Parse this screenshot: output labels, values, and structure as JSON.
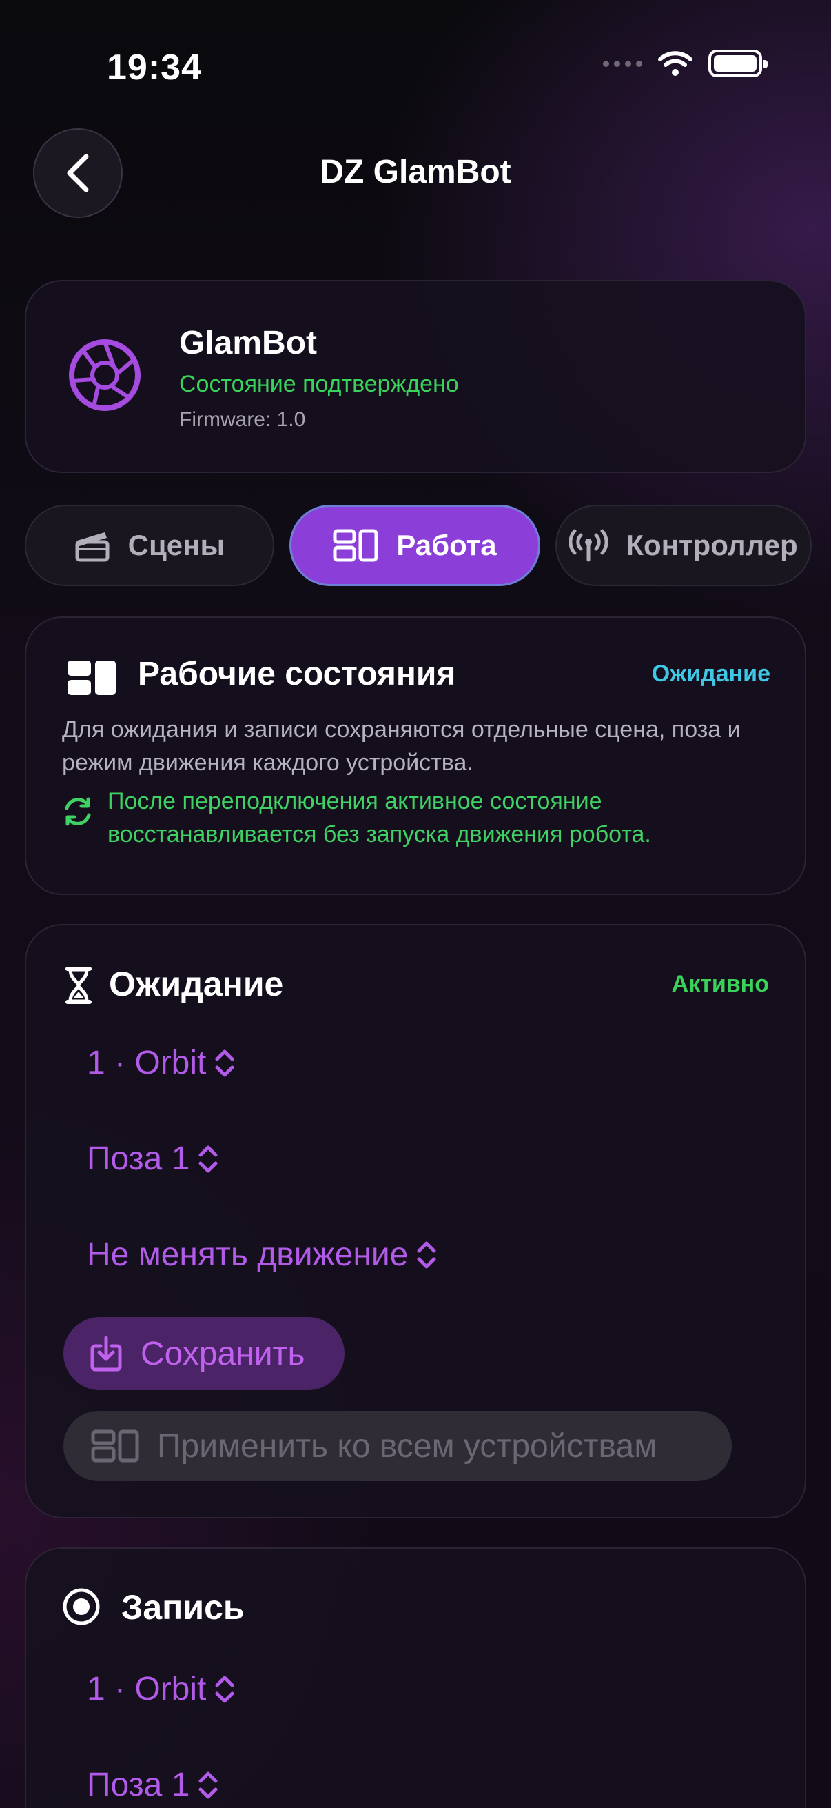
{
  "status_bar": {
    "time": "19:34"
  },
  "nav": {
    "title": "DZ GlamBot"
  },
  "device": {
    "name": "GlamBot",
    "state": "Состояние подтверждено",
    "firmware": "Firmware: 1.0",
    "icon": "aperture-icon"
  },
  "tabs": [
    {
      "label": "Сцены",
      "icon": "clapperboard-icon",
      "active": false
    },
    {
      "label": "Работа",
      "icon": "layout-icon",
      "active": true
    },
    {
      "label": "Контроллер",
      "icon": "antenna-icon",
      "active": false
    }
  ],
  "work_states": {
    "title": "Рабочие состояния",
    "badge": "Ожидание",
    "description": "Для ожидания и записи сохраняются отдельные сцена, поза и режим движения каждого устройства.",
    "note": "После переподключения активное состояние восстанавливается без запуска движения робота."
  },
  "idle": {
    "title": "Ожидание",
    "status": "Активно",
    "scene": "1 · Orbit",
    "pose": "Поза 1",
    "motion": "Не менять движение",
    "save_label": "Сохранить",
    "apply_all_label": "Применить ко всем устройствам"
  },
  "record": {
    "title": "Запись",
    "scene": "1 · Orbit",
    "pose": "Поза 1"
  },
  "colors": {
    "accent_purple": "#8c3fd8",
    "picker_purple": "#b15be8",
    "success_green": "#39d25a",
    "info_cyan": "#3fc8e6"
  }
}
